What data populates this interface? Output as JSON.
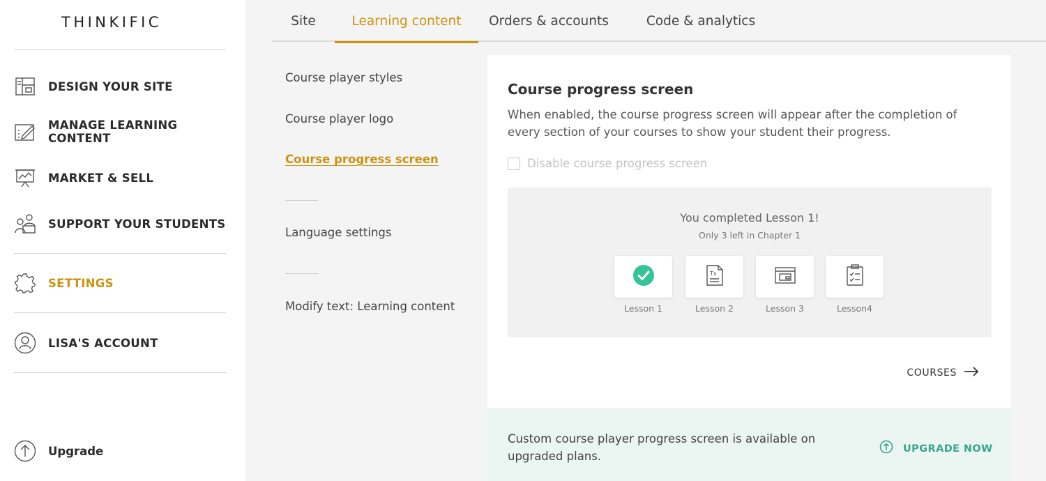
{
  "brand": {
    "logo": "THINKIFIC"
  },
  "sidebar": {
    "items": [
      {
        "label": "DESIGN YOUR SITE",
        "icon": "layout-icon"
      },
      {
        "label": "MANAGE LEARNING CONTENT",
        "icon": "edit-content-icon"
      },
      {
        "label": "MARKET & SELL",
        "icon": "presentation-chart-icon"
      },
      {
        "label": "SUPPORT YOUR STUDENTS",
        "icon": "people-icon"
      },
      {
        "label": "SETTINGS",
        "icon": "gear-icon",
        "active": true
      },
      {
        "label": "LISA'S ACCOUNT",
        "icon": "user-circle-icon"
      }
    ],
    "upgrade": {
      "label": "Upgrade",
      "icon": "arrow-up-circle-icon"
    }
  },
  "tabs": [
    {
      "label": "Site"
    },
    {
      "label": "Learning content",
      "active": true
    },
    {
      "label": "Orders & accounts"
    },
    {
      "label": "Code & analytics"
    }
  ],
  "subnav": {
    "items": [
      "Course player styles",
      "Course player logo",
      "Course progress screen",
      "Language settings",
      "Modify text: Learning content"
    ],
    "active": "Course progress screen"
  },
  "card": {
    "title": "Course progress screen",
    "description": "When enabled, the course progress screen will appear after the completion of every section of your courses to show your student their progress.",
    "checkbox_label": "Disable course progress screen",
    "checkbox_checked": false,
    "preview": {
      "title": "You completed Lesson 1!",
      "subtitle": "Only 3 left in Chapter 1",
      "lessons": [
        {
          "name": "Lesson 1",
          "icon": "check-circle-icon",
          "completed": true
        },
        {
          "name": "Lesson 2",
          "icon": "text-document-icon"
        },
        {
          "name": "Lesson 3",
          "icon": "window-media-icon"
        },
        {
          "name": "Lesson4",
          "icon": "quiz-clipboard-icon"
        }
      ]
    },
    "courses_link": "COURSES"
  },
  "banner": {
    "text": "Custom course player progress screen is available on upgraded plans.",
    "cta": "UPGRADE NOW"
  },
  "colors": {
    "accent": "#cc9313",
    "success": "#34c497",
    "upgrade": "#3aa58a",
    "banner_bg": "#ebf6f3"
  }
}
